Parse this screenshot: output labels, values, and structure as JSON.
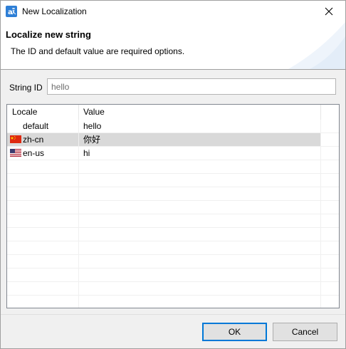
{
  "window": {
    "title": "New Localization",
    "icon": "localization-app-icon"
  },
  "header": {
    "title": "Localize new string",
    "description": "The ID and default value are required options."
  },
  "string_id": {
    "label": "String ID",
    "value": "hello"
  },
  "table": {
    "columns": [
      "Locale",
      "Value"
    ],
    "rows": [
      {
        "locale": "default",
        "value": "hello",
        "flag": null,
        "selected": false
      },
      {
        "locale": "zh-cn",
        "value": "你好",
        "flag": "china-flag-icon",
        "selected": true
      },
      {
        "locale": "en-us",
        "value": "hi",
        "flag": "us-flag-icon",
        "selected": false
      }
    ],
    "selection_color": "#d9d9d9"
  },
  "buttons": {
    "ok": "OK",
    "cancel": "Cancel"
  },
  "colors": {
    "accent": "#0078d7"
  }
}
